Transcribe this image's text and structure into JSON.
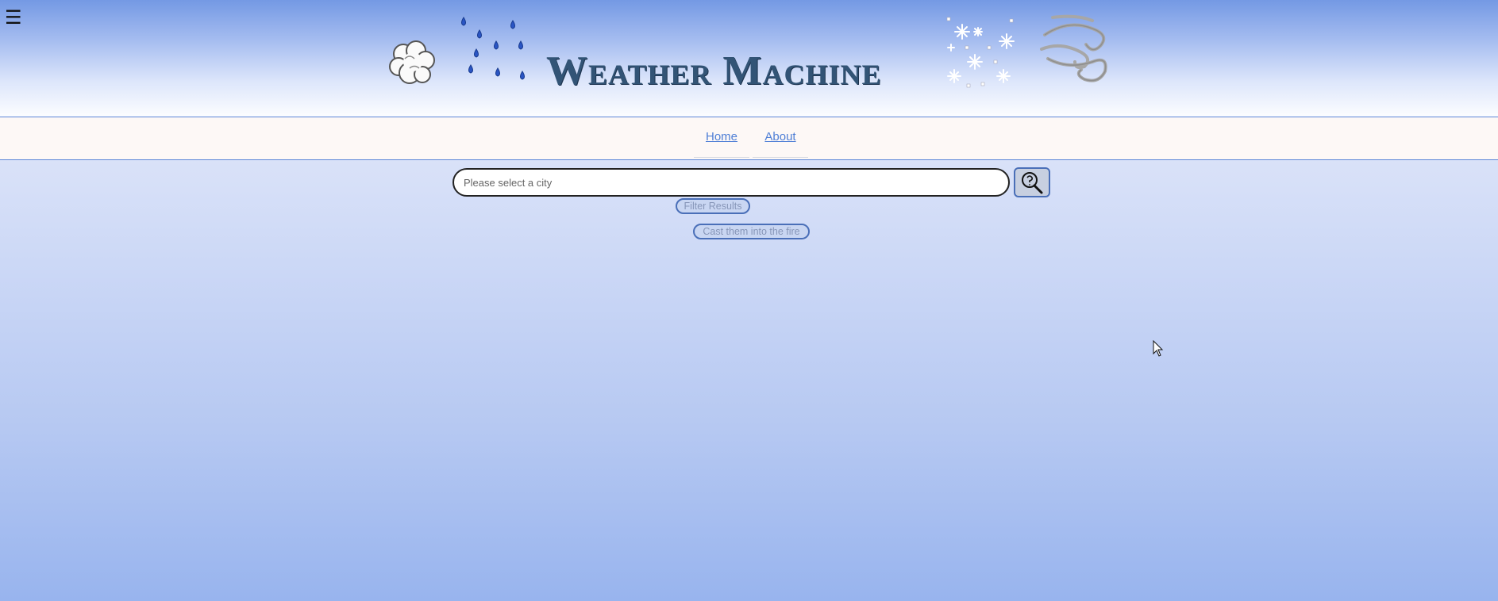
{
  "header": {
    "menu_icon": "hamburger-icon",
    "menu_glyph": "☰",
    "title": "Weather Machine",
    "icons": [
      "cloud-icon",
      "rain-icon",
      "snow-icon",
      "wind-icon"
    ]
  },
  "nav": {
    "items": [
      {
        "label": "Home"
      },
      {
        "label": "About"
      }
    ]
  },
  "search": {
    "placeholder": "Please select a city",
    "value": "",
    "button_icon": "search-icon"
  },
  "actions": {
    "filter_label": "Filter Results",
    "cast_label": "Cast them into the fire"
  },
  "colors": {
    "title": "#325476",
    "link": "#4f7fd6",
    "button_border": "#4a6fb8",
    "rain": "#2a55c4"
  }
}
